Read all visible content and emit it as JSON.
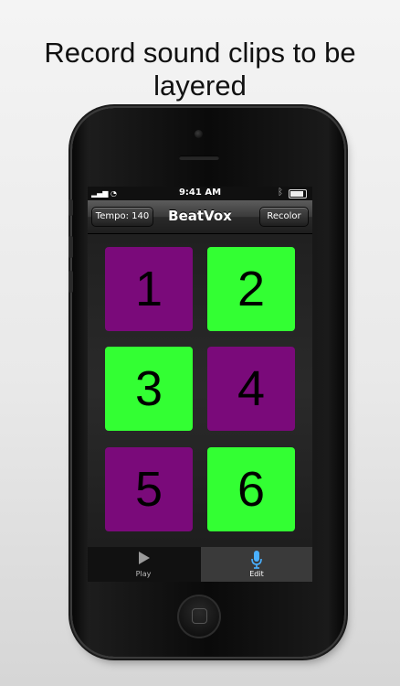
{
  "headline": "Record sound clips to be layered",
  "status_bar": {
    "time": "9:41 AM"
  },
  "nav": {
    "tempo_label": "Tempo: 140",
    "title": "BeatVox",
    "recolor_label": "Recolor"
  },
  "pads": [
    {
      "label": "1",
      "color": "#7a0a7a"
    },
    {
      "label": "2",
      "color": "#33ff33"
    },
    {
      "label": "3",
      "color": "#33ff33"
    },
    {
      "label": "4",
      "color": "#7a0a7a"
    },
    {
      "label": "5",
      "color": "#7a0a7a"
    },
    {
      "label": "6",
      "color": "#33ff33"
    }
  ],
  "tabs": [
    {
      "label": "Play",
      "icon": "play-icon"
    },
    {
      "label": "Edit",
      "icon": "microphone-icon",
      "active": true
    }
  ],
  "colors": {
    "accent_green": "#33ff33",
    "accent_purple": "#7a0a7a",
    "mic_blue": "#4ab0ff"
  }
}
